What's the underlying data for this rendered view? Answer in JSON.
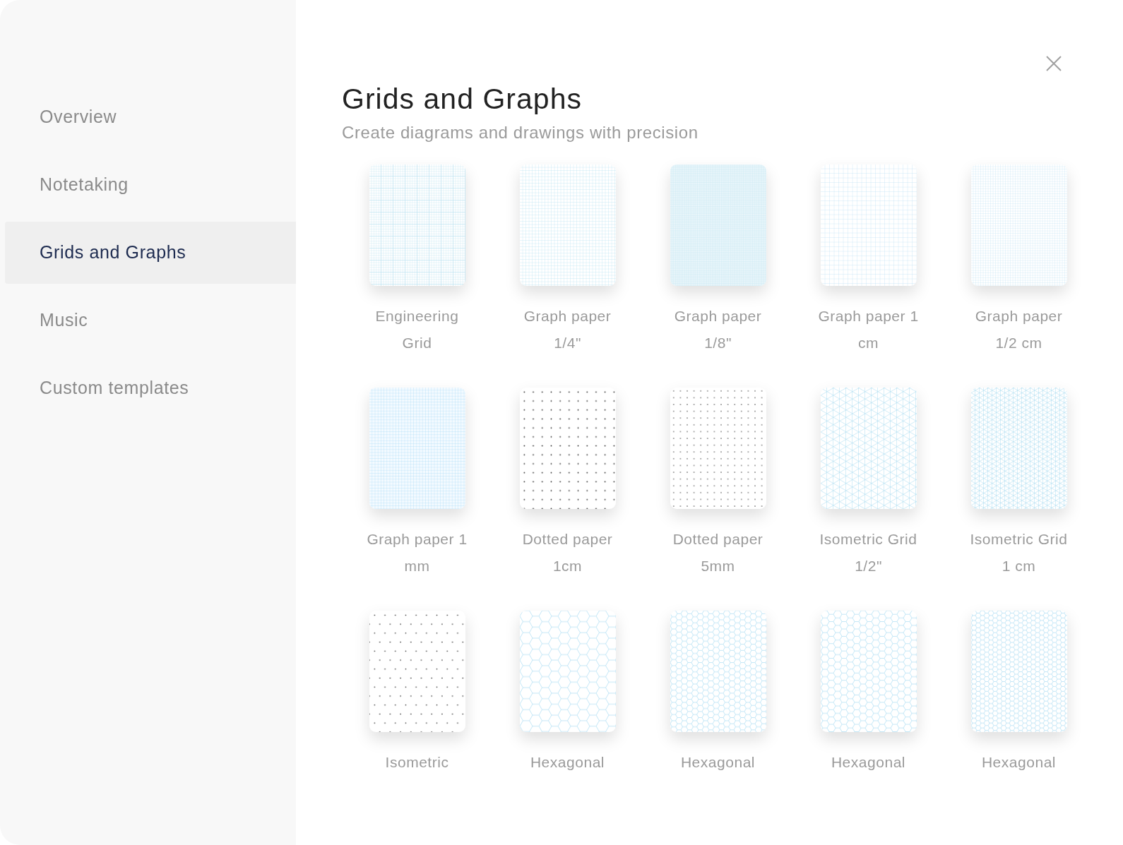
{
  "sidebar": {
    "items": [
      {
        "label": "Overview",
        "selected": false
      },
      {
        "label": "Notetaking",
        "selected": false
      },
      {
        "label": "Grids and Graphs",
        "selected": true
      },
      {
        "label": "Music",
        "selected": false
      },
      {
        "label": "Custom templates",
        "selected": false
      }
    ]
  },
  "header": {
    "title": "Grids and Graphs",
    "subtitle": "Create diagrams and drawings with precision"
  },
  "templates": [
    {
      "label": "Engineering Grid",
      "kind": "engineering"
    },
    {
      "label": "Graph paper 1/4\"",
      "kind": "grid_quarter"
    },
    {
      "label": "Graph paper 1/8\"",
      "kind": "grid_eighth"
    },
    {
      "label": "Graph paper 1 cm",
      "kind": "grid_cm"
    },
    {
      "label": "Graph paper 1/2 cm",
      "kind": "grid_halfcm"
    },
    {
      "label": "Graph paper 1 mm",
      "kind": "grid_mm"
    },
    {
      "label": "Dotted paper 1cm",
      "kind": "dots_large"
    },
    {
      "label": "Dotted paper 5mm",
      "kind": "dots_small"
    },
    {
      "label": "Isometric Grid 1/2\"",
      "kind": "iso_large"
    },
    {
      "label": "Isometric Grid 1 cm",
      "kind": "iso_small"
    },
    {
      "label": "Isometric",
      "kind": "iso_dots"
    },
    {
      "label": "Hexagonal",
      "kind": "hex_large"
    },
    {
      "label": "Hexagonal",
      "kind": "hex_medium"
    },
    {
      "label": "Hexagonal",
      "kind": "hex_small"
    },
    {
      "label": "Hexagonal",
      "kind": "hex_tiny"
    }
  ]
}
